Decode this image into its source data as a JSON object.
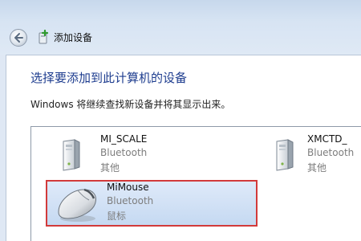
{
  "window": {
    "title": "添加设备"
  },
  "main": {
    "heading": "选择要添加到此计算机的设备",
    "subtext": "Windows 将继续查找新设备并将其显示出来。"
  },
  "devices": [
    {
      "name": "MI_SCALE",
      "protocol": "Bluetooth",
      "category": "其他",
      "icon": "tower-icon"
    },
    {
      "name": "XMCTD_",
      "protocol": "Bluetooth",
      "category": "其他",
      "icon": "tower-icon"
    },
    {
      "name": "MiMouse",
      "protocol": "Bluetooth",
      "category": "鼠标",
      "icon": "mouse-icon",
      "selected": true
    }
  ],
  "colors": {
    "heading": "#1e3d8f",
    "selection_fill": "#c5d9f2",
    "selection_border": "#d23a3a",
    "secondary_text": "#7d7d7d"
  }
}
